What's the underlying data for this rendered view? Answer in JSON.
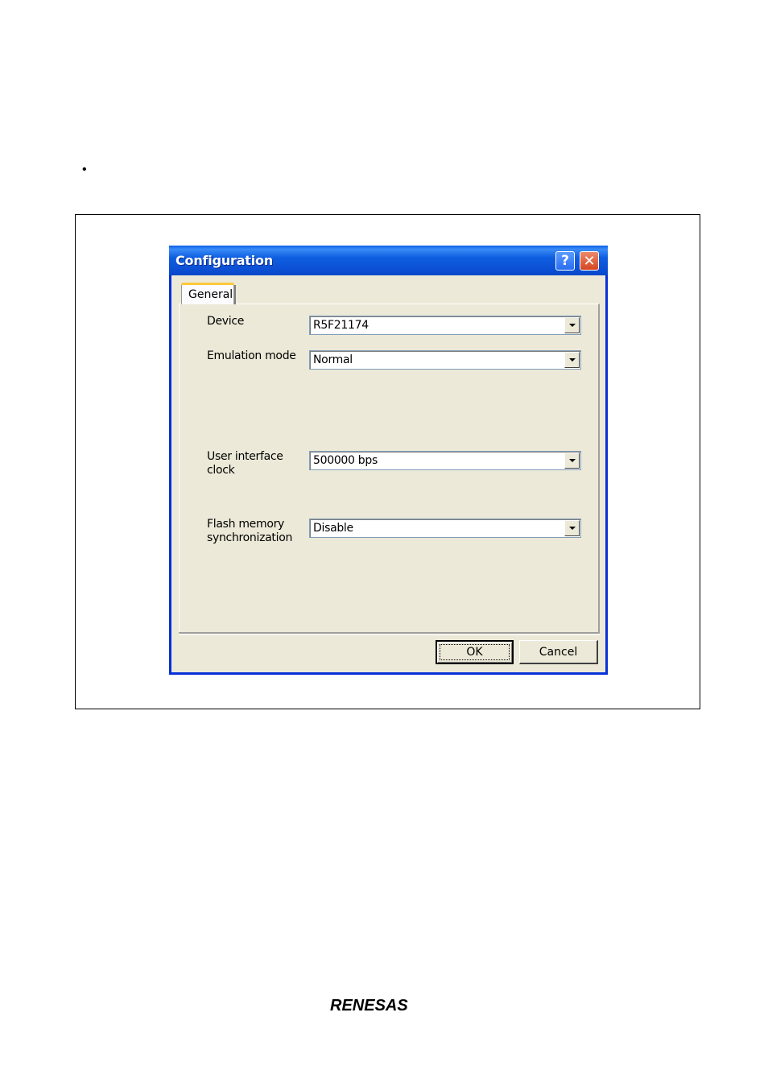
{
  "page": {
    "bullet": "•",
    "logo_text": "RENESAS"
  },
  "dialog": {
    "title": "Configuration",
    "help_glyph": "?",
    "close_glyph": "✕",
    "tab_label": "General",
    "fields": {
      "device": {
        "label": "Device",
        "value": "R5F21174"
      },
      "emulation_mode": {
        "label": "Emulation mode",
        "value": "Normal"
      },
      "ui_clock": {
        "label_line1": "User interface",
        "label_line2": "clock",
        "value": "500000 bps"
      },
      "flash_sync": {
        "label_line1": "Flash memory",
        "label_line2": "synchronization",
        "value": "Disable"
      }
    },
    "ok_label": "OK",
    "cancel_label": "Cancel"
  },
  "colors": {
    "titlebar": "#0a55e0",
    "dialog_bg": "#ece9d8",
    "tab_highlight": "#ffc83c"
  }
}
